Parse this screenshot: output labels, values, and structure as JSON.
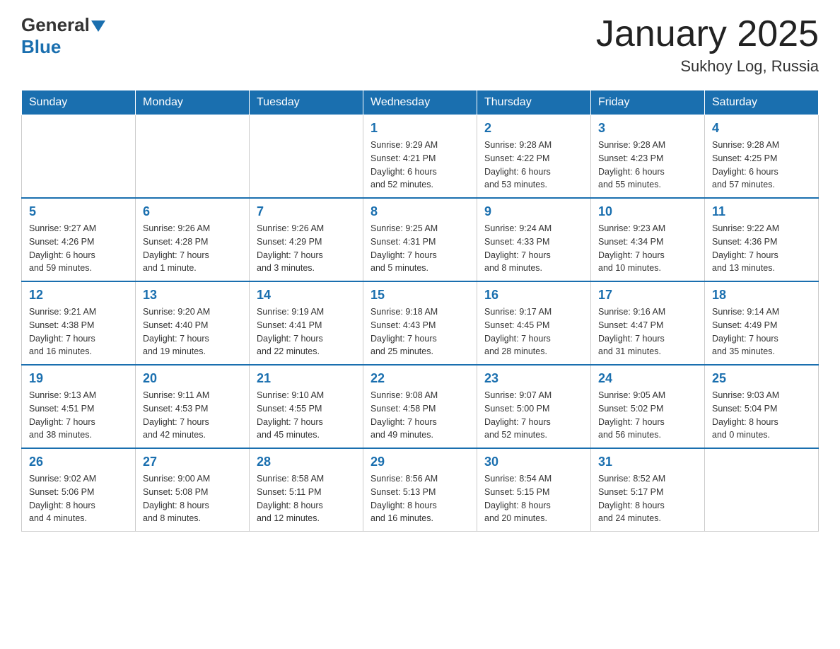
{
  "header": {
    "logo": {
      "general": "General",
      "blue": "Blue"
    },
    "title": "January 2025",
    "location": "Sukhoy Log, Russia"
  },
  "days_of_week": [
    "Sunday",
    "Monday",
    "Tuesday",
    "Wednesday",
    "Thursday",
    "Friday",
    "Saturday"
  ],
  "weeks": [
    [
      {
        "day": "",
        "info": ""
      },
      {
        "day": "",
        "info": ""
      },
      {
        "day": "",
        "info": ""
      },
      {
        "day": "1",
        "info": "Sunrise: 9:29 AM\nSunset: 4:21 PM\nDaylight: 6 hours\nand 52 minutes."
      },
      {
        "day": "2",
        "info": "Sunrise: 9:28 AM\nSunset: 4:22 PM\nDaylight: 6 hours\nand 53 minutes."
      },
      {
        "day": "3",
        "info": "Sunrise: 9:28 AM\nSunset: 4:23 PM\nDaylight: 6 hours\nand 55 minutes."
      },
      {
        "day": "4",
        "info": "Sunrise: 9:28 AM\nSunset: 4:25 PM\nDaylight: 6 hours\nand 57 minutes."
      }
    ],
    [
      {
        "day": "5",
        "info": "Sunrise: 9:27 AM\nSunset: 4:26 PM\nDaylight: 6 hours\nand 59 minutes."
      },
      {
        "day": "6",
        "info": "Sunrise: 9:26 AM\nSunset: 4:28 PM\nDaylight: 7 hours\nand 1 minute."
      },
      {
        "day": "7",
        "info": "Sunrise: 9:26 AM\nSunset: 4:29 PM\nDaylight: 7 hours\nand 3 minutes."
      },
      {
        "day": "8",
        "info": "Sunrise: 9:25 AM\nSunset: 4:31 PM\nDaylight: 7 hours\nand 5 minutes."
      },
      {
        "day": "9",
        "info": "Sunrise: 9:24 AM\nSunset: 4:33 PM\nDaylight: 7 hours\nand 8 minutes."
      },
      {
        "day": "10",
        "info": "Sunrise: 9:23 AM\nSunset: 4:34 PM\nDaylight: 7 hours\nand 10 minutes."
      },
      {
        "day": "11",
        "info": "Sunrise: 9:22 AM\nSunset: 4:36 PM\nDaylight: 7 hours\nand 13 minutes."
      }
    ],
    [
      {
        "day": "12",
        "info": "Sunrise: 9:21 AM\nSunset: 4:38 PM\nDaylight: 7 hours\nand 16 minutes."
      },
      {
        "day": "13",
        "info": "Sunrise: 9:20 AM\nSunset: 4:40 PM\nDaylight: 7 hours\nand 19 minutes."
      },
      {
        "day": "14",
        "info": "Sunrise: 9:19 AM\nSunset: 4:41 PM\nDaylight: 7 hours\nand 22 minutes."
      },
      {
        "day": "15",
        "info": "Sunrise: 9:18 AM\nSunset: 4:43 PM\nDaylight: 7 hours\nand 25 minutes."
      },
      {
        "day": "16",
        "info": "Sunrise: 9:17 AM\nSunset: 4:45 PM\nDaylight: 7 hours\nand 28 minutes."
      },
      {
        "day": "17",
        "info": "Sunrise: 9:16 AM\nSunset: 4:47 PM\nDaylight: 7 hours\nand 31 minutes."
      },
      {
        "day": "18",
        "info": "Sunrise: 9:14 AM\nSunset: 4:49 PM\nDaylight: 7 hours\nand 35 minutes."
      }
    ],
    [
      {
        "day": "19",
        "info": "Sunrise: 9:13 AM\nSunset: 4:51 PM\nDaylight: 7 hours\nand 38 minutes."
      },
      {
        "day": "20",
        "info": "Sunrise: 9:11 AM\nSunset: 4:53 PM\nDaylight: 7 hours\nand 42 minutes."
      },
      {
        "day": "21",
        "info": "Sunrise: 9:10 AM\nSunset: 4:55 PM\nDaylight: 7 hours\nand 45 minutes."
      },
      {
        "day": "22",
        "info": "Sunrise: 9:08 AM\nSunset: 4:58 PM\nDaylight: 7 hours\nand 49 minutes."
      },
      {
        "day": "23",
        "info": "Sunrise: 9:07 AM\nSunset: 5:00 PM\nDaylight: 7 hours\nand 52 minutes."
      },
      {
        "day": "24",
        "info": "Sunrise: 9:05 AM\nSunset: 5:02 PM\nDaylight: 7 hours\nand 56 minutes."
      },
      {
        "day": "25",
        "info": "Sunrise: 9:03 AM\nSunset: 5:04 PM\nDaylight: 8 hours\nand 0 minutes."
      }
    ],
    [
      {
        "day": "26",
        "info": "Sunrise: 9:02 AM\nSunset: 5:06 PM\nDaylight: 8 hours\nand 4 minutes."
      },
      {
        "day": "27",
        "info": "Sunrise: 9:00 AM\nSunset: 5:08 PM\nDaylight: 8 hours\nand 8 minutes."
      },
      {
        "day": "28",
        "info": "Sunrise: 8:58 AM\nSunset: 5:11 PM\nDaylight: 8 hours\nand 12 minutes."
      },
      {
        "day": "29",
        "info": "Sunrise: 8:56 AM\nSunset: 5:13 PM\nDaylight: 8 hours\nand 16 minutes."
      },
      {
        "day": "30",
        "info": "Sunrise: 8:54 AM\nSunset: 5:15 PM\nDaylight: 8 hours\nand 20 minutes."
      },
      {
        "day": "31",
        "info": "Sunrise: 8:52 AM\nSunset: 5:17 PM\nDaylight: 8 hours\nand 24 minutes."
      },
      {
        "day": "",
        "info": ""
      }
    ]
  ]
}
